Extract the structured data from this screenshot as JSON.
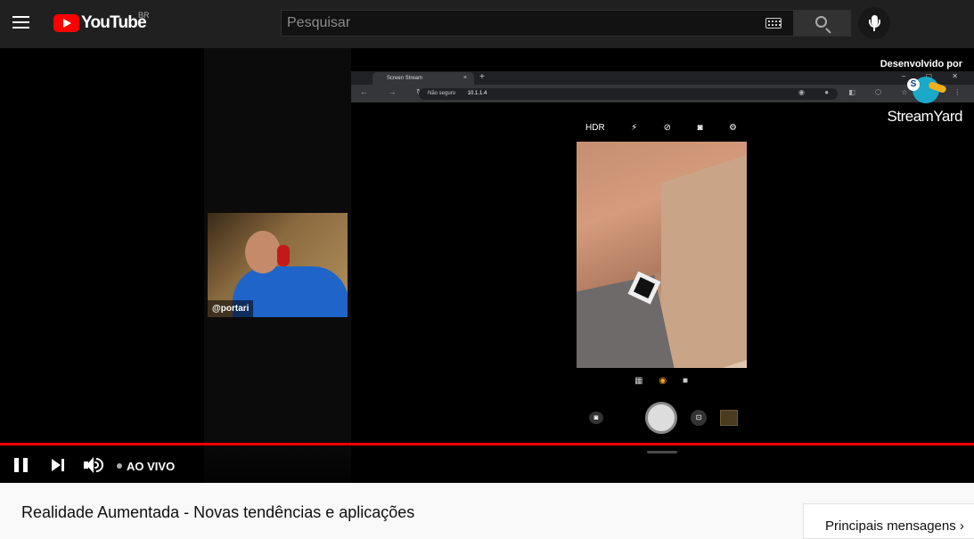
{
  "masthead": {
    "logo_text": "YouTube",
    "country_code": "BR",
    "search_placeholder": "Pesquisar",
    "icons": [
      "menu-icon",
      "keyboard-icon",
      "search-icon",
      "microphone-icon"
    ]
  },
  "screen_share": {
    "tab_title": "Screen Stream",
    "tab_close": "×",
    "new_tab": "+",
    "window_controls": "‒ ▢ ✕",
    "nav_glyphs": "← → ↻",
    "address_security": "Não seguro",
    "address_url": "10.1.1.4",
    "extension_glyphs": "◉ ● ◧ ⬡ ☆ ◫ ⋮",
    "camera_toolbar": [
      "HDR",
      "⚡",
      "⊘",
      "◙",
      "⚙"
    ],
    "camera_modes": [
      "▦",
      "◉",
      "■"
    ],
    "gallery_glyph": "◙",
    "lens_glyph": "⊡"
  },
  "webcam": {
    "name_tag": "@portari"
  },
  "branding": {
    "developed_by": "Desenvolvido por",
    "badge": "S",
    "brand_name": "StreamYard"
  },
  "player": {
    "live_label": "AO VIVO",
    "progress_fraction": 1.0,
    "accent_color": "#ff0000"
  },
  "video": {
    "title": "Realidade Aumentada - Novas tendências e aplicações"
  },
  "chat": {
    "mode_label": "Principais mensagens ›"
  }
}
